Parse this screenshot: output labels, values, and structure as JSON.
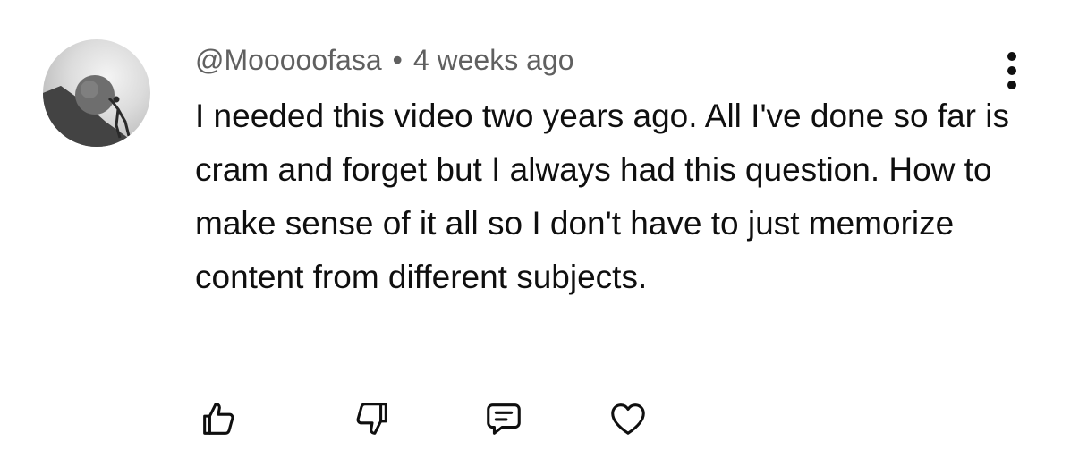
{
  "comment": {
    "author": "@Mooooofasa",
    "separator": "•",
    "timestamp": "4 weeks ago",
    "text": "I needed this video two years ago. All I've done so far is cram and forget but I always had this question. How to make sense of it all so I don't have to just memorize content from different subjects.",
    "avatar_icon": "sisyphus-boulder-avatar"
  },
  "actions": [
    {
      "icon": "thumbs-up-icon"
    },
    {
      "icon": "thumbs-down-icon"
    },
    {
      "icon": "reply-icon"
    },
    {
      "icon": "heart-icon"
    }
  ],
  "menu": {
    "icon": "more-vertical-icon"
  },
  "colors": {
    "text_primary": "#0f0f0f",
    "text_secondary": "#606060",
    "background": "#ffffff"
  }
}
